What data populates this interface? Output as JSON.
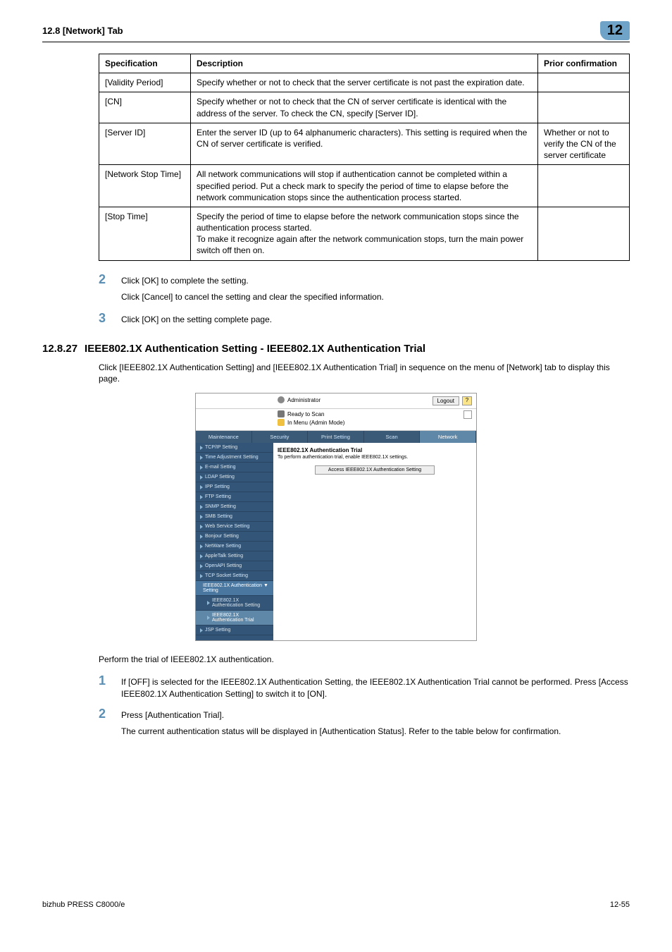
{
  "header": {
    "left": "12.8    [Network] Tab",
    "right": "12"
  },
  "table": {
    "head": [
      "Specification",
      "Description",
      "Prior confirmation"
    ],
    "rows": [
      {
        "c1": "[Validity Period]",
        "c2": "Specify whether or not to check that the server certificate is not past the expiration date.",
        "c3": ""
      },
      {
        "c1": "[CN]",
        "c2": "Specify whether or not to check that the CN of server certificate is identical with the address of the server. To check the CN, specify [Server ID].",
        "c3": ""
      },
      {
        "c1": "[Server ID]",
        "c2": "Enter the server ID (up to 64 alphanumeric characters). This setting is required when the CN of server certificate is verified.",
        "c3": "Whether or not to verify the CN of the server certificate"
      },
      {
        "c1": "[Network Stop Time]",
        "c2": "All network communications will stop if authentication cannot be completed within a specified period. Put a check mark to specify the period of time to elapse before the network communication stops since the authentication process started.",
        "c3": ""
      },
      {
        "c1": "[Stop Time]",
        "c2": "Specify the period of time to elapse before the network communication stops since the authentication process started.\nTo make it recognize again after the network communication stops, turn the main power switch off then on.",
        "c3": ""
      }
    ]
  },
  "steps_a": [
    {
      "n": "2",
      "t": "Click [OK] to complete the setting.",
      "sub": "Click [Cancel] to cancel the setting and clear the specified information."
    },
    {
      "n": "3",
      "t": "Click [OK] on the setting complete page.",
      "sub": ""
    }
  ],
  "section": {
    "num": "12.8.27",
    "title": "IEEE802.1X Authentication Setting - IEEE802.1X Authentication Trial"
  },
  "intro": "Click [IEEE802.1X Authentication Setting] and [IEEE802.1X Authentication Trial] in sequence on the menu of [Network] tab to display this page.",
  "screenshot": {
    "admin": "Administrator",
    "logout": "Logout",
    "help": "?",
    "status1": "Ready to Scan",
    "status2": "In Menu (Admin Mode)",
    "tabs": [
      "Maintenance",
      "Security",
      "Print Setting",
      "Scan",
      "Network"
    ],
    "active_tab": 4,
    "sidebar": [
      "TCP/IP Setting",
      "Time Adjustment Setting",
      "E-mail Setting",
      "LDAP Setting",
      "IPP Setting",
      "FTP Setting",
      "SNMP Setting",
      "SMB Setting",
      "Web Service Setting",
      "Bonjour Setting",
      "NetWare Setting",
      "AppleTalk Setting",
      "OpenAPI Setting",
      "TCP Socket Setting"
    ],
    "sidebar_group": "IEEE802.1X Authentication ▼ Setting",
    "sidebar_sub1": "IEEE802.1X Authentication Setting",
    "sidebar_sub2": "IEEE802.1X Authentication Trial",
    "sidebar_last": "JSP Setting",
    "main_title": "IEEE802.1X Authentication Trial",
    "main_note": "To perform authentication trial, enable IEEE802.1X settings.",
    "main_button": "Access IEEE802.1X Authentication Setting"
  },
  "after_para": "Perform the trial of IEEE802.1X authentication.",
  "steps_b": [
    {
      "n": "1",
      "t": "If [OFF] is selected for the IEEE802.1X Authentication Setting, the IEEE802.1X Authentication Trial cannot be performed. Press [Access IEEE802.1X Authentication Setting] to switch it to [ON].",
      "sub": ""
    },
    {
      "n": "2",
      "t": "Press [Authentication Trial].",
      "sub": "The current authentication status will be displayed in [Authentication Status]. Refer to the table below for confirmation."
    }
  ],
  "footer": {
    "left": "bizhub PRESS C8000/e",
    "right": "12-55"
  }
}
